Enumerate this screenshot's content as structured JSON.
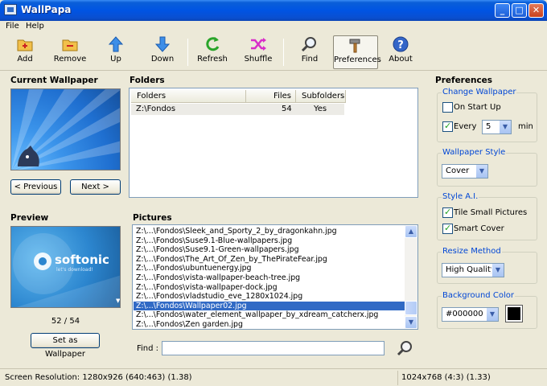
{
  "window": {
    "title": "WallPapa"
  },
  "menu": {
    "items": [
      "File",
      "Help"
    ]
  },
  "toolbar": {
    "add": "Add",
    "remove": "Remove",
    "up": "Up",
    "down": "Down",
    "refresh": "Refresh",
    "shuffle": "Shuffle",
    "find": "Find",
    "preferences": "Preferences",
    "about": "About"
  },
  "current": {
    "heading": "Current Wallpaper",
    "previous": "< Previous",
    "next": "Next >"
  },
  "folders": {
    "heading": "Folders",
    "columns": [
      "Folders",
      "Files",
      "Subfolders"
    ],
    "rows": [
      {
        "path": "Z:\\Fondos",
        "files": "54",
        "subfolders": "Yes"
      }
    ]
  },
  "preview": {
    "heading": "Preview",
    "logo_text": "softonic",
    "logo_sub": "let's download!",
    "counter": "52 / 54",
    "set_button": "Set as Wallpaper"
  },
  "pictures": {
    "heading": "Pictures",
    "items": [
      "Z:\\...\\Fondos\\Sleek_and_Sporty_2_by_dragonkahn.jpg",
      "Z:\\...\\Fondos\\Suse9.1-Blue-wallpapers.jpg",
      "Z:\\...\\Fondos\\Suse9.1-Green-wallpapers.jpg",
      "Z:\\...\\Fondos\\The_Art_Of_Zen_by_ThePirateFear.jpg",
      "Z:\\...\\Fondos\\ubuntuenergy.jpg",
      "Z:\\...\\Fondos\\vista-wallpaper-beach-tree.jpg",
      "Z:\\...\\Fondos\\vista-wallpaper-dock.jpg",
      "Z:\\...\\Fondos\\vladstudio_eve_1280x1024.jpg",
      "Z:\\...\\Fondos\\Wallpaper02.jpg",
      "Z:\\...\\Fondos\\water_element_wallpaper_by_xdream_catcherx.jpg",
      "Z:\\...\\Fondos\\Zen garden.jpg"
    ],
    "selected_index": 8
  },
  "find": {
    "label": "Find :",
    "value": ""
  },
  "preferences": {
    "heading": "Preferences",
    "change": {
      "title": "Change Wallpaper",
      "on_start_up": "On Start Up",
      "on_start_up_checked": false,
      "every": "Every",
      "every_checked": true,
      "interval": "5",
      "unit": "min"
    },
    "style": {
      "title": "Wallpaper Style",
      "value": "Cover"
    },
    "ai": {
      "title": "Style A.I.",
      "tile_small": "Tile Small Pictures",
      "tile_small_checked": true,
      "smart_cover": "Smart Cover",
      "smart_cover_checked": true
    },
    "resize": {
      "title": "Resize Method",
      "value": "High Quality"
    },
    "background": {
      "title": "Background Color",
      "value": "#000000",
      "swatch": "#000000"
    }
  },
  "status": {
    "screen": "Screen Resolution: 1280x926  (640:463)  (1.38)",
    "image": "1024x768  (4:3)  (1.33)"
  },
  "colors": {
    "titlebar": "#0054e3",
    "selection": "#316ac5",
    "group_title": "#0046d5"
  }
}
